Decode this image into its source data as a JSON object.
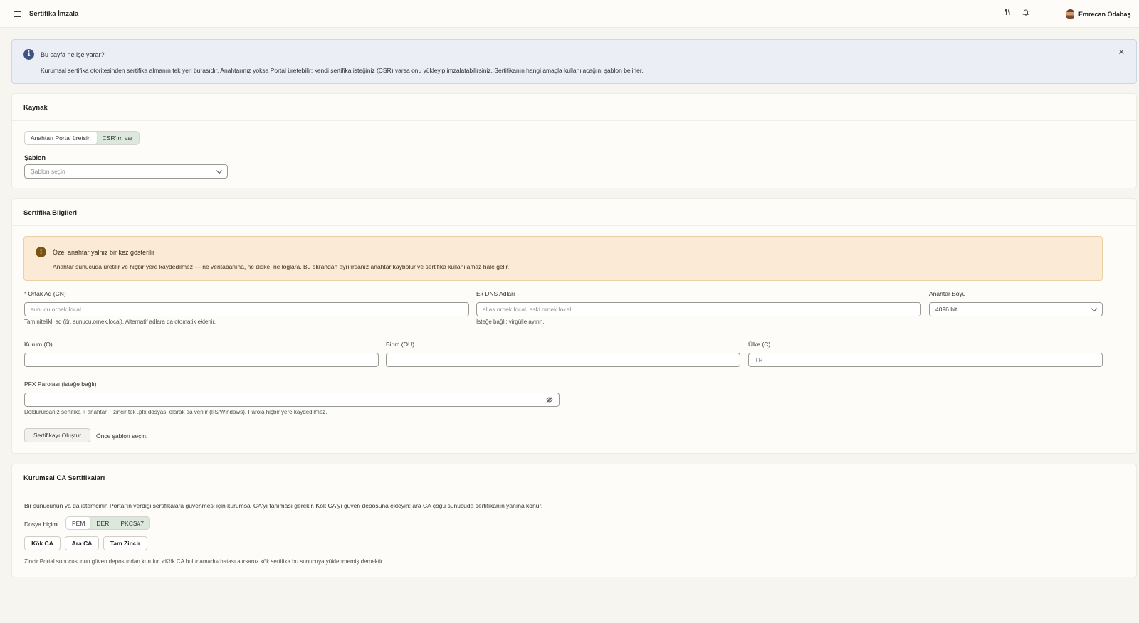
{
  "topbar": {
    "title": "Sertifika İmzala",
    "user_name": "Emrecan Odabaş",
    "icons": [
      "menu-icon",
      "tools-icon",
      "bell-icon",
      "avatar"
    ]
  },
  "info_banner": {
    "heading": "Bu sayfa ne işe yarar?",
    "body": "Kurumsal sertifika otoritesinden sertifika almanın tek yeri burasıdır. Anahtarınız yoksa Portal üretebilir; kendi sertifika isteğiniz (CSR) varsa onu yükleyip imzalatabilirsiniz. Sertifikanın hangi amaçla kullanılacağını şablon belirler."
  },
  "source_card": {
    "title": "Kaynak",
    "segment_options": [
      "Anahtarı Portal üretsin",
      "CSR'ım var"
    ],
    "selected_option": "Anahtarı Portal üretsin",
    "template_label": "Şablon",
    "template_placeholder": "Şablon seçin"
  },
  "cert_info_card": {
    "title": "Sertifika Bilgileri",
    "warning": {
      "heading": "Özel anahtar yalnız bir kez gösterilir",
      "body": "Anahtar sunucuda üretilir ve hiçbir yere kaydedilmez — ne veritabanına, ne diske, ne loglara. Bu ekrandan ayrılırsanız anahtar kaybolur ve sertifika kullanılamaz hâle gelir."
    },
    "cn": {
      "required_mark": "*",
      "label": "Ortak Ad (CN)",
      "placeholder": "sunucu.ornek.local",
      "help": "Tam nitelikli ad (ör. sunucu.ornek.local). Alternatif adlara da otomatik eklenir."
    },
    "dns": {
      "label": "Ek DNS Adları",
      "placeholder": "alias.ornek.local, eski.ornek.local",
      "help": "İsteğe bağlı; virgülle ayırın."
    },
    "key_size": {
      "label": "Anahtar Boyu",
      "value": "4096 bit"
    },
    "org": {
      "label": "Kurum (O)",
      "value": ""
    },
    "ou": {
      "label": "Birim (OU)",
      "value": ""
    },
    "country": {
      "label": "Ülke (C)",
      "placeholder": "TR"
    },
    "pfx": {
      "label": "PFX Parolası (isteğe bağlı)",
      "value": "",
      "help": "Doldurursanız sertifika + anahtar + zincir tek .pfx dosyası olarak da verilir (IIS/Windows). Parola hiçbir yere kaydedilmez."
    },
    "create_button": "Sertifikayı Oluştur",
    "create_hint": "Önce şablon seçin."
  },
  "ca_card": {
    "title": "Kurumsal CA Sertifikaları",
    "description": "Bir sunucunun ya da istemcinin Portal'ın verdiği sertifikalara güvenmesi için kurumsal CA'yı tanıması gerekir. Kök CA'yı güven deposuna ekleyin; ara CA çoğu sunucuda sertifikanın yanına konur.",
    "format_label": "Dosya biçimi",
    "formats": [
      "PEM",
      "DER",
      "PKCS#7"
    ],
    "selected_format": "PEM",
    "buttons": [
      "Kök CA",
      "Ara CA",
      "Tam Zincir"
    ],
    "footer": "Zincir Portal sunucusunun güven deposundan kurulur. «Kök CA bulunamadı» hatası alırsanız kök sertifika bu sunucuya yüklenmemiş demektir."
  }
}
